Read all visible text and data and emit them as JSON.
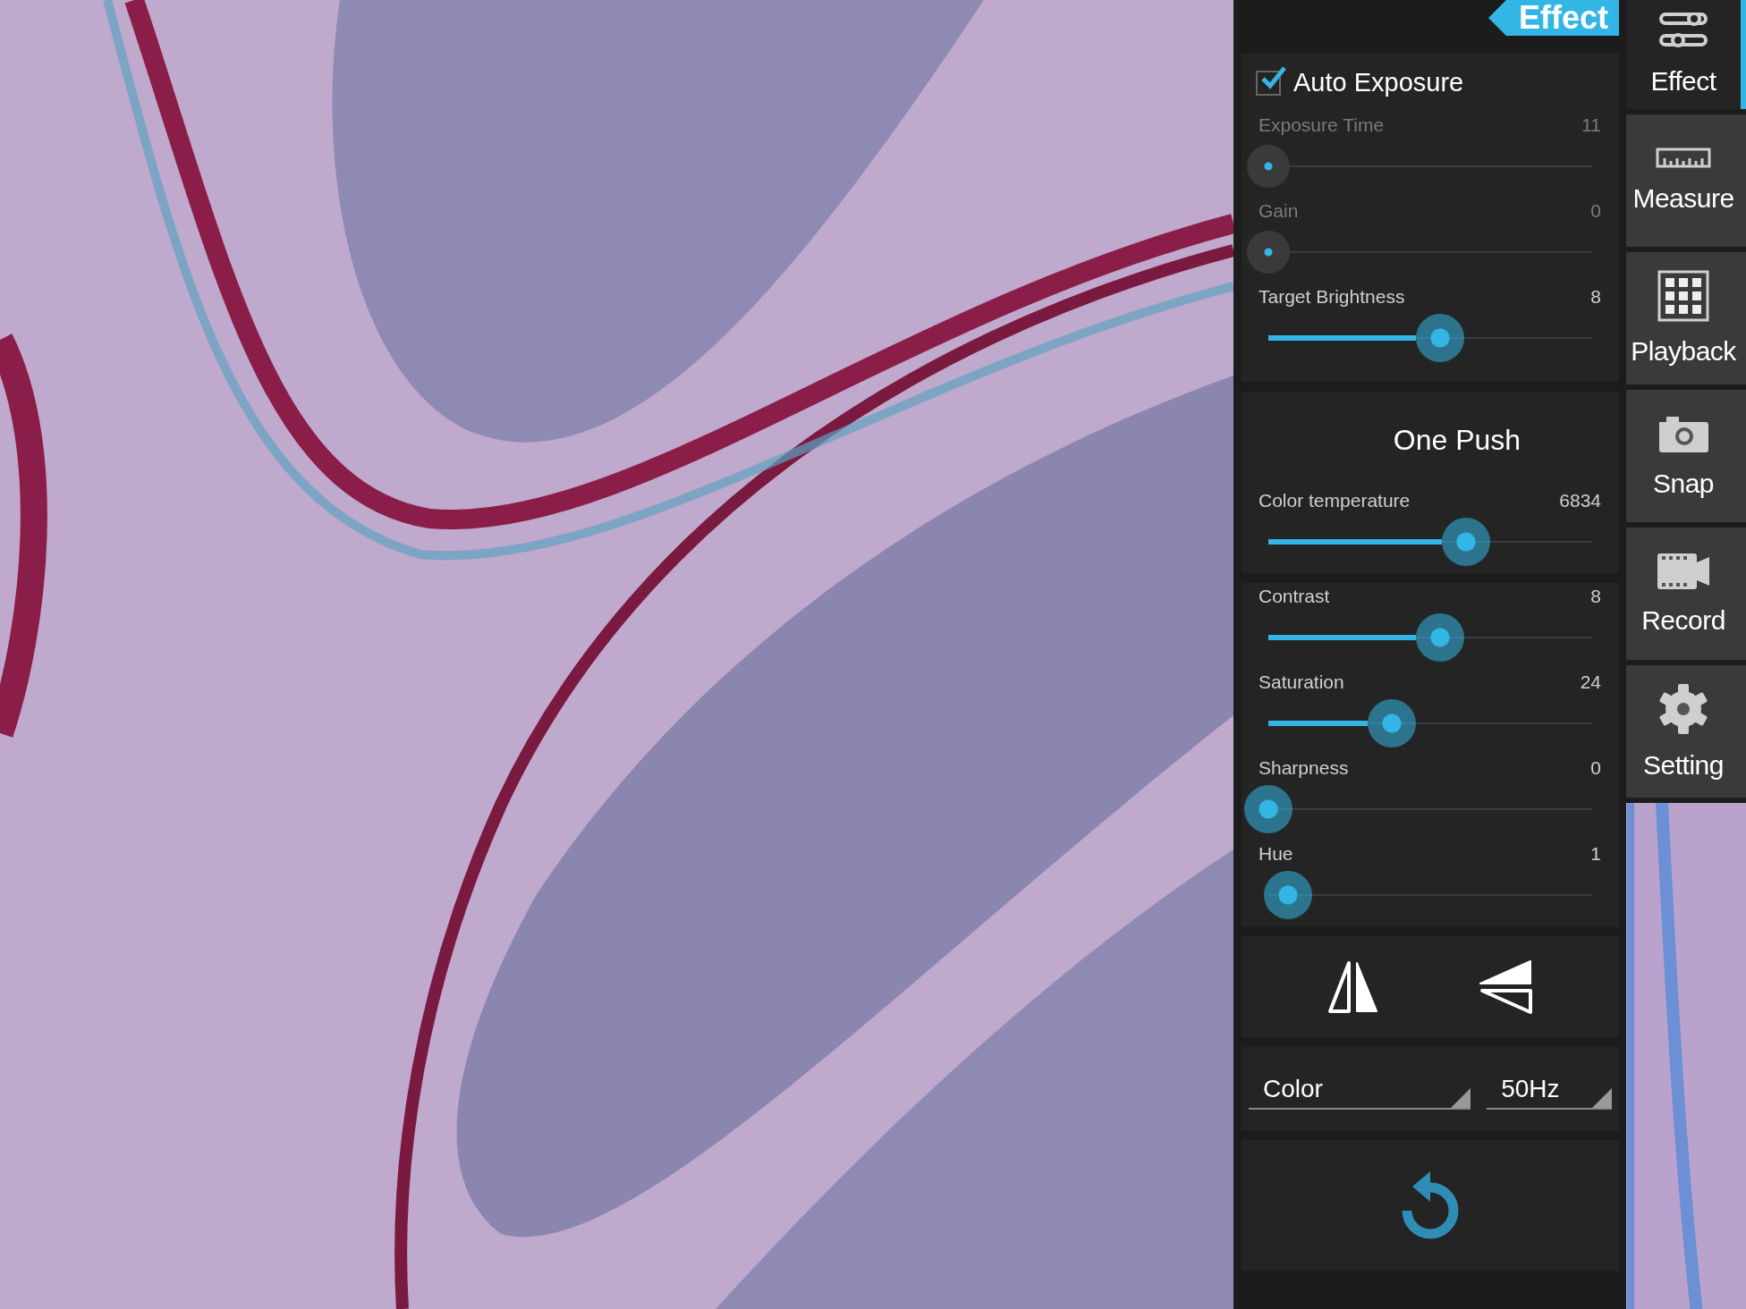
{
  "panel": {
    "title": "Effect",
    "auto_exposure": {
      "label": "Auto Exposure",
      "checked": true
    },
    "exposure_sliders": [
      {
        "label": "Exposure Time",
        "value": "11",
        "level": 0,
        "disabled": true
      },
      {
        "label": "Gain",
        "value": "0",
        "level": 0,
        "disabled": true
      },
      {
        "label": "Target Brightness",
        "value": "8",
        "level": 0.53,
        "disabled": false
      }
    ],
    "white_balance": {
      "button": "One Push",
      "sliders": [
        {
          "label": "Color temperature",
          "value": "6834",
          "level": 0.61,
          "disabled": false
        }
      ]
    },
    "image_sliders": [
      {
        "label": "Contrast",
        "value": "8",
        "level": 0.53,
        "disabled": false
      },
      {
        "label": "Saturation",
        "value": "24",
        "level": 0.38,
        "disabled": false
      },
      {
        "label": "Sharpness",
        "value": "0",
        "level": 0,
        "disabled": false
      },
      {
        "label": "Hue",
        "value": "1",
        "level": 0.06,
        "disabled": false
      }
    ],
    "dropdowns": [
      {
        "value": "Color"
      },
      {
        "value": "50Hz"
      }
    ]
  },
  "sidebar": {
    "items": [
      {
        "label": "Effect",
        "selected": true
      },
      {
        "label": "Measure",
        "selected": false
      },
      {
        "label": "Playback",
        "selected": false
      },
      {
        "label": "Snap",
        "selected": false
      },
      {
        "label": "Record",
        "selected": false
      },
      {
        "label": "Setting",
        "selected": false
      }
    ]
  }
}
